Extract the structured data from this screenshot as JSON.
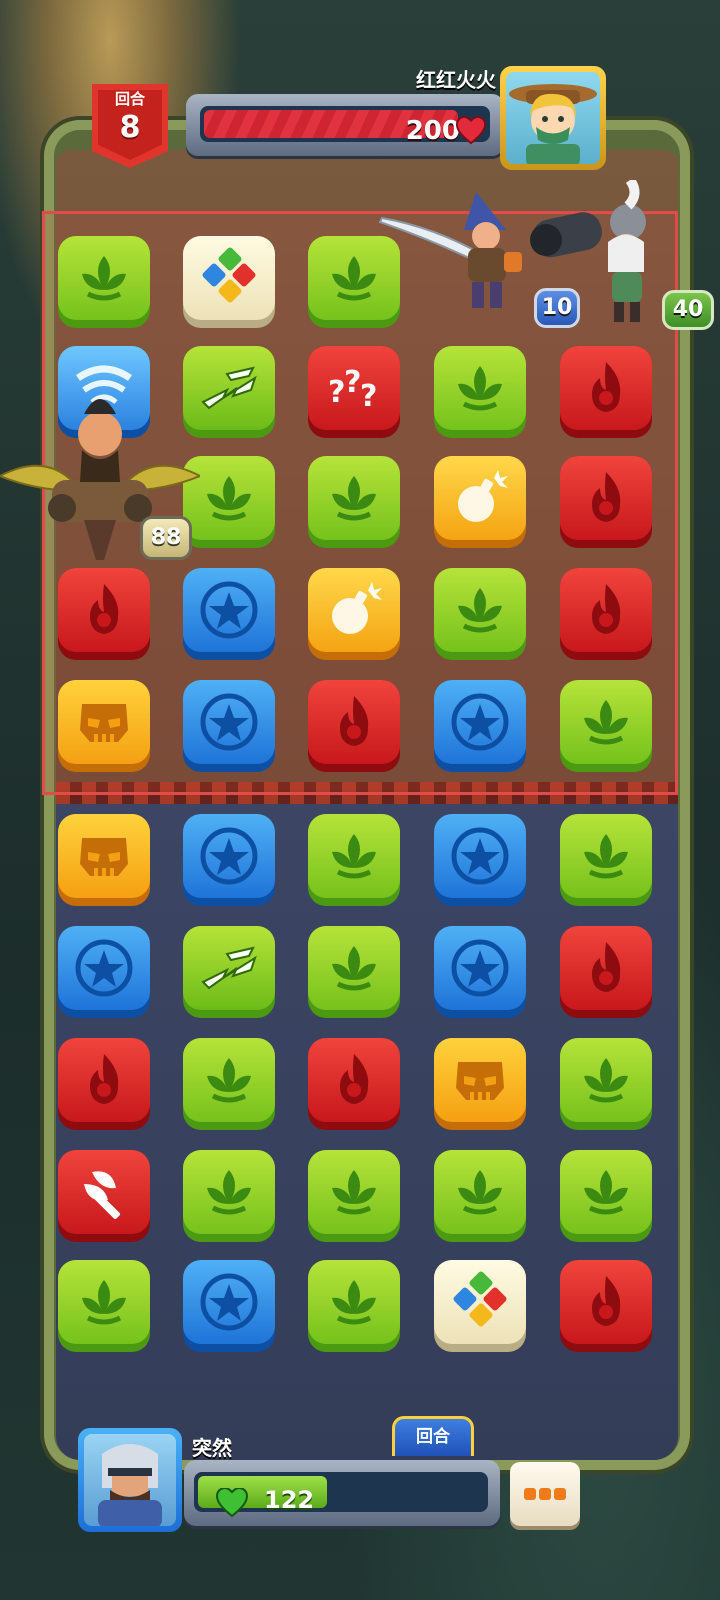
{
  "hud": {
    "round_label": "回合",
    "round_number": "8",
    "opponent": {
      "name": "红红火火",
      "hp": "200",
      "hp_fraction": 0.9
    },
    "player": {
      "name": "突然",
      "hp": "122",
      "hp_fraction": 0.45,
      "turn_tab_label": "回合"
    }
  },
  "units": {
    "enemy_swordsman_value": "10",
    "enemy_cannoneer_value": "40",
    "player_hero_value": "88"
  },
  "colors": {
    "leaf": "#76c21c",
    "fire": "#c8181c",
    "star": "#1f74d8",
    "skull": "#f4a012",
    "enemy_zone_border": "#e34b4b"
  },
  "board": {
    "columns": 5,
    "rows": [
      [
        "leaf",
        "rainbow",
        "leaf",
        null,
        null
      ],
      [
        "tornado",
        "bolt",
        "mystery",
        "leaf",
        "fire"
      ],
      [
        null,
        "leaf",
        "leaf",
        "bomb",
        "fire"
      ],
      [
        "fire",
        "star",
        "bomb",
        "leaf",
        "fire"
      ],
      [
        "skull",
        "star",
        "fire",
        "star",
        "leaf"
      ],
      [
        "skull",
        "star",
        "leaf",
        "star",
        "leaf"
      ],
      [
        "star",
        "bolt",
        "leaf",
        "star",
        "fire"
      ],
      [
        "fire",
        "leaf",
        "fire",
        "skull",
        "leaf"
      ],
      [
        "axe",
        "leaf",
        "leaf",
        "leaf",
        "leaf"
      ],
      [
        "leaf",
        "star",
        "leaf",
        "rainbow",
        "fire"
      ]
    ]
  }
}
